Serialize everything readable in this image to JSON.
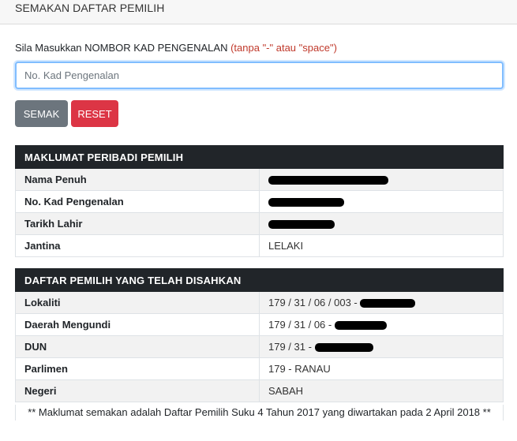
{
  "header": {
    "title": "SEMAKAN DAFTAR PEMILIH"
  },
  "form": {
    "instruction": "Sila Masukkan NOMBOR KAD PENGENALAN",
    "instruction_hint": "(tanpa \"-\" atau \"space\")",
    "ic_placeholder": "No. Kad Pengenalan",
    "ic_value": "",
    "semak_label": "SEMAK",
    "reset_label": "RESET"
  },
  "personal": {
    "heading": "MAKLUMAT PERIBADI PEMILIH",
    "rows": [
      {
        "label": "Nama Penuh",
        "value": ""
      },
      {
        "label": "No. Kad Pengenalan",
        "value": ""
      },
      {
        "label": "Tarikh Lahir",
        "value": ""
      },
      {
        "label": "Jantina",
        "value": "LELAKI"
      }
    ]
  },
  "register": {
    "heading": "DAFTAR PEMILIH YANG TELAH DISAHKAN",
    "rows": [
      {
        "label": "Lokaliti",
        "value": "179 / 31 / 06 / 003 -"
      },
      {
        "label": "Daerah Mengundi",
        "value": "179 / 31 / 06 -"
      },
      {
        "label": "DUN",
        "value": "179 / 31 -"
      },
      {
        "label": "Parlimen",
        "value": "179 - RANAU"
      },
      {
        "label": "Negeri",
        "value": "SABAH"
      }
    ]
  },
  "note": "** Maklumat semakan adalah Daftar Pemilih Suku 4 Tahun 2017 yang diwartakan pada 2 April 2018 **",
  "colors": {
    "dark_header": "#212529",
    "semak": "#6c757d",
    "reset": "#dc3545",
    "hint_red": "#c0392b"
  }
}
